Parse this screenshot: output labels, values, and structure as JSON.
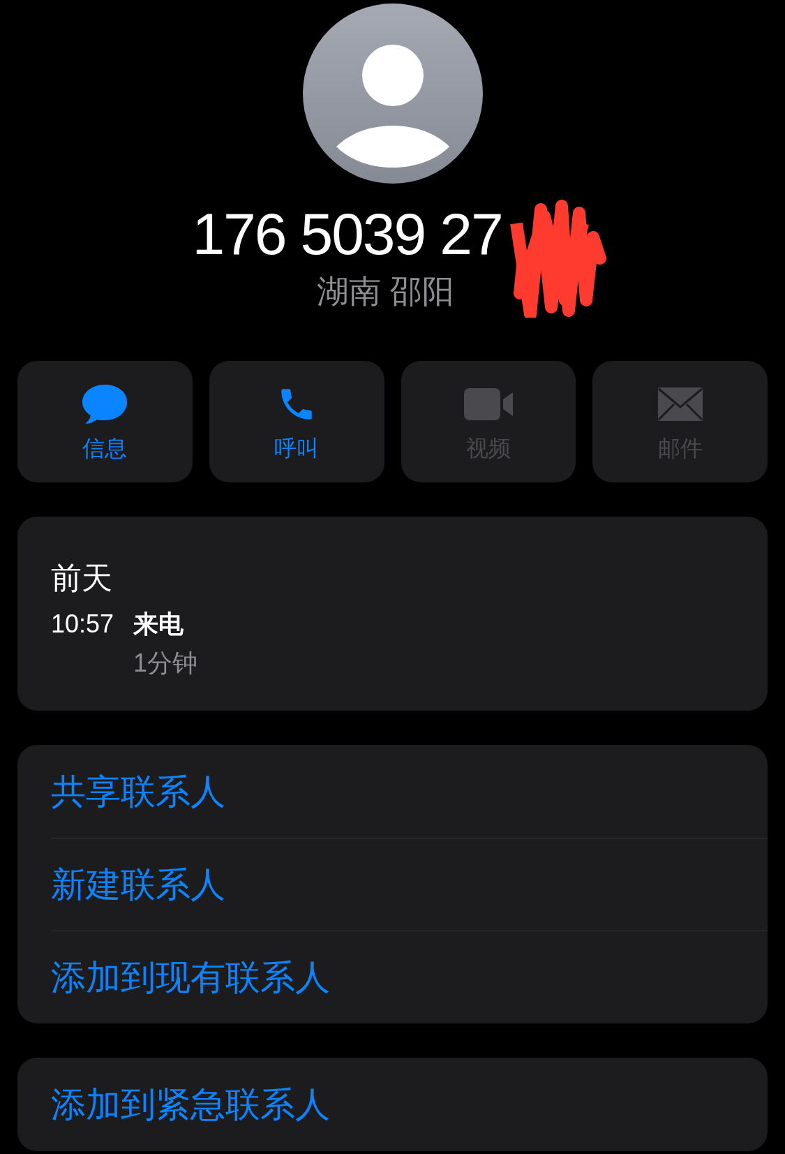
{
  "header": {
    "number": "176 5039 27",
    "location": "湖南 邵阳"
  },
  "actions": [
    {
      "kind": "message",
      "label": "信息",
      "disabled": false
    },
    {
      "kind": "phone",
      "label": "呼叫",
      "disabled": false
    },
    {
      "kind": "video",
      "label": "视频",
      "disabled": true
    },
    {
      "kind": "mail",
      "label": "邮件",
      "disabled": true
    }
  ],
  "call_history": {
    "date": "前天",
    "calls": [
      {
        "time": "10:57",
        "type": "来电",
        "duration": "1分钟"
      }
    ]
  },
  "menu": [
    {
      "label": "共享联系人"
    },
    {
      "label": "新建联系人"
    },
    {
      "label": "添加到现有联系人"
    }
  ],
  "emergency": {
    "label": "添加到紧急联系人"
  }
}
